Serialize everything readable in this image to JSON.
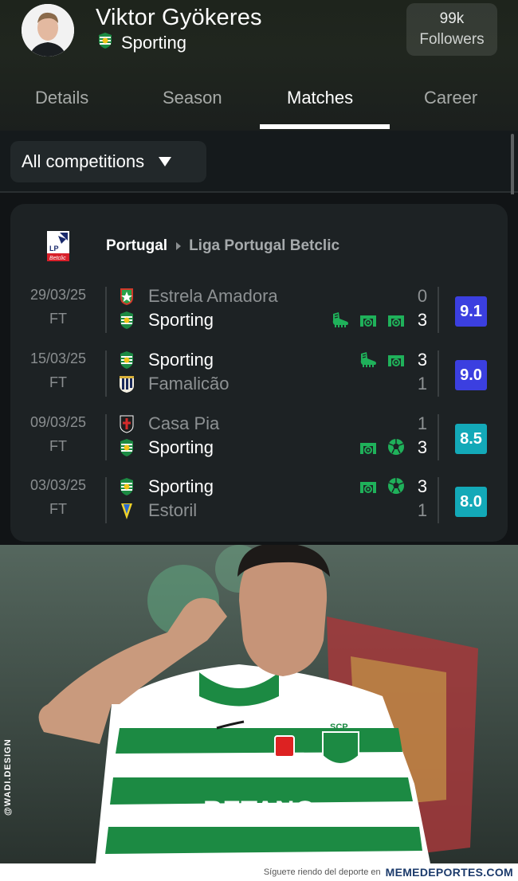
{
  "profile": {
    "name": "Viktor Gyökeres",
    "club": "Sporting",
    "followers_count": "99k",
    "followers_label": "Followers"
  },
  "tabs": [
    {
      "label": "Details",
      "active": false
    },
    {
      "label": "Season",
      "active": false
    },
    {
      "label": "Matches",
      "active": true
    },
    {
      "label": "Career",
      "active": false
    }
  ],
  "filter": {
    "selected": "All competitions"
  },
  "league": {
    "country": "Portugal",
    "name": "Liga Portugal Betclic",
    "logo_text": "LP",
    "logo_subtext": "Betclic"
  },
  "matches": [
    {
      "date": "29/03/25",
      "status": "FT",
      "home": {
        "name": "Estrela Amadora",
        "score": "0",
        "winner": false,
        "crest": "estrela-crest"
      },
      "away": {
        "name": "Sporting",
        "score": "3",
        "winner": true,
        "crest": "sporting-crest"
      },
      "events_row": 2,
      "events": [
        "assist-boot-icon",
        "goal-icon",
        "goal-icon"
      ],
      "rating": "9.1",
      "rating_color": "#3b3fe0"
    },
    {
      "date": "15/03/25",
      "status": "FT",
      "home": {
        "name": "Sporting",
        "score": "3",
        "winner": true,
        "crest": "sporting-crest"
      },
      "away": {
        "name": "Famalicão",
        "score": "1",
        "winner": false,
        "crest": "famalicao-crest"
      },
      "events_row": 1,
      "events": [
        "assist-boot-icon",
        "goal-icon"
      ],
      "rating": "9.0",
      "rating_color": "#3b3fe0"
    },
    {
      "date": "09/03/25",
      "status": "FT",
      "home": {
        "name": "Casa Pia",
        "score": "1",
        "winner": false,
        "crest": "casapia-crest"
      },
      "away": {
        "name": "Sporting",
        "score": "3",
        "winner": true,
        "crest": "sporting-crest"
      },
      "events_row": 2,
      "events": [
        "goal-icon",
        "ball-icon"
      ],
      "rating": "8.5",
      "rating_color": "#13a9b8"
    },
    {
      "date": "03/03/25",
      "status": "FT",
      "home": {
        "name": "Sporting",
        "score": "3",
        "winner": true,
        "crest": "sporting-crest"
      },
      "away": {
        "name": "Estoril",
        "score": "1",
        "winner": false,
        "crest": "estoril-crest"
      },
      "events_row": 1,
      "events": [
        "goal-icon",
        "ball-icon"
      ],
      "rating": "8.0",
      "rating_color": "#13a9b8"
    }
  ],
  "photo": {
    "jersey_sponsor": "BETANO",
    "badge_text": "SCP",
    "watermark": "@WADI.DESIGN"
  },
  "footer": {
    "text": "Sígueте riendo del deporte en",
    "site": "MEMEDEPORTES.COM"
  },
  "colors": {
    "accent_green": "#1fb15a",
    "rating_high": "#3b3fe0",
    "rating_mid": "#13a9b8"
  }
}
